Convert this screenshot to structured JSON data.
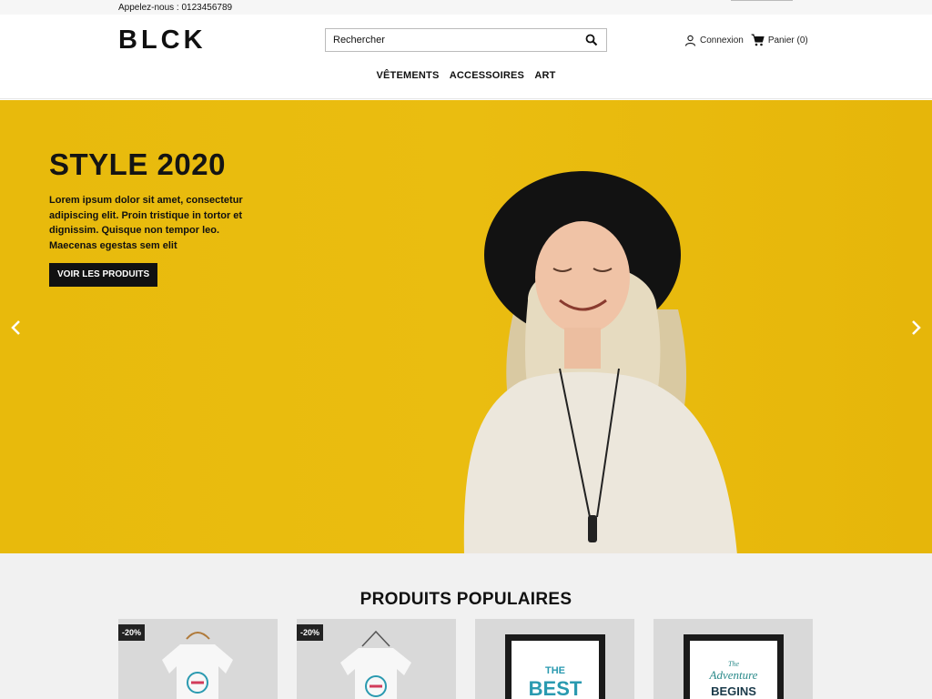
{
  "topbar": {
    "phone": "Appelez-nous : 0123456789"
  },
  "header": {
    "logo": "BLCK",
    "search_placeholder": "Rechercher",
    "login": "Connexion",
    "cart": "Panier (0)"
  },
  "nav": [
    "VÊTEMENTS",
    "ACCESSOIRES",
    "ART"
  ],
  "hero": {
    "title": "STYLE 2020",
    "description": "Lorem ipsum dolor sit amet, consectetur adipiscing elit. Proin tristique in tortor et dignissim. Quisque non tempor leo. Maecenas egestas sem elit",
    "cta": "VOIR LES PRODUITS"
  },
  "products": {
    "heading": "PRODUITS POPULAIRES",
    "items": [
      {
        "badge": "-20%"
      },
      {
        "badge": "-20%"
      },
      {
        "badge": "",
        "poster_text": [
          "THE",
          "BEST"
        ]
      },
      {
        "badge": "",
        "poster_text": [
          "The",
          "Adventure",
          "BEGINS"
        ]
      }
    ]
  },
  "colors": {
    "hero_yellow": "#e8ba0c",
    "dark": "#111111",
    "products_bg": "#f1f1f1"
  }
}
